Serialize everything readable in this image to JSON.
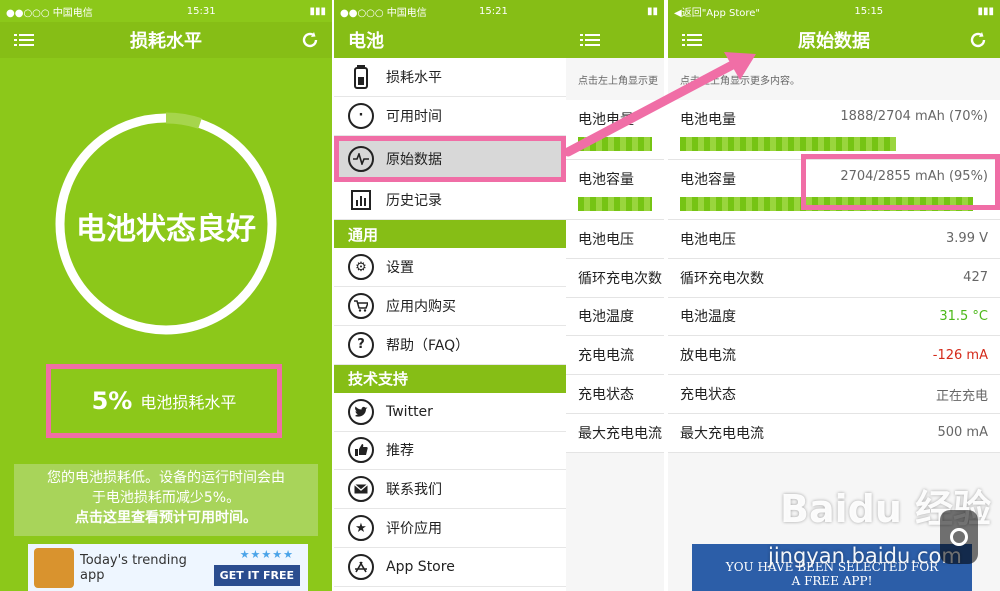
{
  "screen1": {
    "status_carrier": "●●○○○ 中国电信",
    "status_time": "15:31",
    "title": "损耗水平",
    "ring_text": "电池状态良好",
    "level_percent": "5%",
    "level_label": "电池损耗水平",
    "desc_line1": "您的电池损耗低。设备的运行时间会由",
    "desc_line2": "于电池损耗而减少5%。",
    "desc_cta": "点击这里查看预计可用时间。",
    "ad_title": "Today's trending app",
    "ad_button": "GET IT FREE",
    "ad_stars": "★★★★★",
    "icons": {
      "menu": "menu-icon",
      "refresh": "refresh-icon"
    }
  },
  "screen2": {
    "status_carrier": "●●○○○ 中国电信",
    "status_time": "15:21",
    "header": "电池",
    "items": [
      {
        "label": "损耗水平",
        "icon": "battery-icon"
      },
      {
        "label": "可用时间",
        "icon": "clock-icon"
      },
      {
        "label": "原始数据",
        "icon": "waveform-icon"
      },
      {
        "label": "历史记录",
        "icon": "chart-icon"
      }
    ],
    "section_general": "通用",
    "general_items": [
      {
        "label": "设置",
        "icon": "gear-icon"
      },
      {
        "label": "应用内购买",
        "icon": "cart-icon"
      },
      {
        "label": "帮助（FAQ）",
        "icon": "help-icon"
      }
    ],
    "section_support": "技术支持",
    "support_items": [
      {
        "label": "Twitter",
        "icon": "twitter-icon"
      },
      {
        "label": "推荐",
        "icon": "thumbs-up-icon"
      },
      {
        "label": "联系我们",
        "icon": "mail-icon"
      },
      {
        "label": "评价应用",
        "icon": "star-icon"
      },
      {
        "label": "App Store",
        "icon": "app-store-icon"
      }
    ]
  },
  "screen3": {
    "hint": "点击左上角显示更",
    "rows": [
      "电池电量",
      "电池容量",
      "电池电压",
      "循环充电次数",
      "电池温度",
      "充电电流",
      "充电状态",
      "最大充电电流"
    ]
  },
  "screen4": {
    "status_back": "◀返回\"App Store\"",
    "status_time": "15:15",
    "title": "原始数据",
    "hint": "点击左上角显示更多内容。",
    "rows": [
      {
        "label": "电池电量",
        "value": "1888/2704 mAh (70%)"
      },
      {
        "label": "电池容量",
        "value": "2704/2855 mAh (95%)"
      },
      {
        "label": "电池电压",
        "value": "3.99 V"
      },
      {
        "label": "循环充电次数",
        "value": "427"
      },
      {
        "label": "电池温度",
        "value": "31.5 °C"
      },
      {
        "label": "放电电流",
        "value": "-126 mA"
      },
      {
        "label": "充电状态",
        "value": "正在充电"
      },
      {
        "label": "最大充电电流",
        "value": "500 mA"
      }
    ],
    "level_fraction": 0.7,
    "capacity_fraction": 0.95,
    "ad_line1": "YOU HAVE BEEN SELECTED FOR",
    "ad_line2": "A FREE APP!"
  },
  "watermark": {
    "logo": "Baidu 经验",
    "sub": "jingyan.baidu.com"
  },
  "colors": {
    "brand_green": "#86be16",
    "highlight_pink": "#f06ea6",
    "temp_green": "#4cb819",
    "current_red": "#d42a1a"
  }
}
